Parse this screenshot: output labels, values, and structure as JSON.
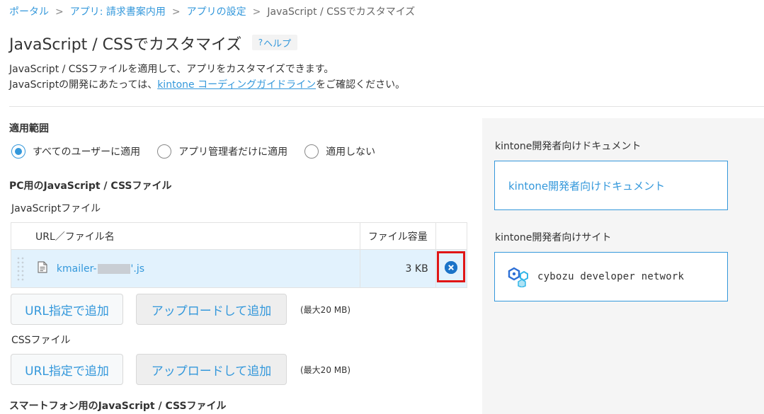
{
  "breadcrumb": {
    "items": [
      {
        "label": "ポータル",
        "link": true
      },
      {
        "label": "アプリ: 請求書案内用",
        "link": true
      },
      {
        "label": "アプリの設定",
        "link": true
      },
      {
        "label": "JavaScript / CSSでカスタマイズ",
        "link": false
      }
    ],
    "separator": ">"
  },
  "header": {
    "title": "JavaScript / CSSでカスタマイズ",
    "help_icon": "?",
    "help_label": "ヘルプ"
  },
  "description": {
    "line1": "JavaScript / CSSファイルを適用して、アプリをカスタマイズできます。",
    "line2_prefix": "JavaScriptの開発にあたっては、",
    "line2_link": "kintone コーディングガイドライン",
    "line2_suffix": "をご確認ください。"
  },
  "scope": {
    "title": "適用範囲",
    "options": [
      {
        "label": "すべてのユーザーに適用",
        "checked": true
      },
      {
        "label": "アプリ管理者だけに適用",
        "checked": false
      },
      {
        "label": "適用しない",
        "checked": false
      }
    ]
  },
  "pc": {
    "title": "PC用のJavaScript / CSSファイル",
    "js_label": "JavaScriptファイル",
    "table": {
      "headers": [
        "URL／ファイル名",
        "ファイル容量",
        ""
      ],
      "rows": [
        {
          "name_prefix": "kmailer-",
          "name_suffix": "'.js",
          "size": "3 KB"
        }
      ]
    },
    "js_buttons": {
      "url": "URL指定で追加",
      "upload": "アップロードして追加",
      "max": "(最大20 MB)"
    },
    "css_label": "CSSファイル",
    "css_buttons": {
      "url": "URL指定で追加",
      "upload": "アップロードして追加",
      "max": "(最大20 MB)"
    }
  },
  "smartphone": {
    "title": "スマートフォン用のJavaScript / CSSファイル"
  },
  "sidebar": {
    "doc_heading": "kintone開発者向けドキュメント",
    "doc_link": "kintone開発者向けドキュメント",
    "site_heading": "kintone開発者向けサイト",
    "site_link": "cybozu developer network"
  },
  "colors": {
    "accent": "#3498db",
    "row_highlight": "#e2f2fd",
    "delete_button": "#1a73c8",
    "annotation": "#e01616"
  }
}
